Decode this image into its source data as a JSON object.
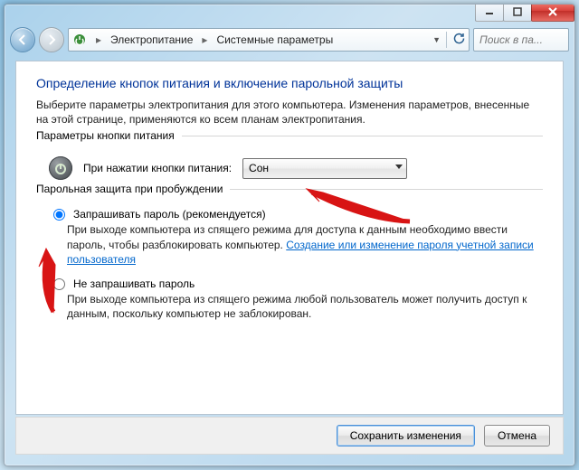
{
  "breadcrumb": {
    "item1": "Электропитание",
    "item2": "Системные параметры"
  },
  "search": {
    "placeholder": "Поиск в па..."
  },
  "page": {
    "heading": "Определение кнопок питания и включение парольной защиты",
    "description": "Выберите параметры электропитания для этого компьютера. Изменения параметров, внесенные на этой странице, применяются ко всем планам электропитания."
  },
  "powerButtons": {
    "legend": "Параметры кнопки питания",
    "label": "При нажатии кнопки питания:",
    "value": "Сон"
  },
  "passwordProtect": {
    "legend": "Парольная защита при пробуждении",
    "opt1": {
      "title": "Запрашивать пароль (рекомендуется)",
      "desc_a": "При выходе компьютера из спящего режима для доступа к данным необходимо ввести пароль, чтобы разблокировать компьютер. ",
      "link": "Создание или изменение пароля учетной записи пользователя"
    },
    "opt2": {
      "title": "Не запрашивать пароль",
      "desc": "При выходе компьютера из спящего режима любой пользователь может получить доступ к данным, поскольку компьютер не заблокирован."
    }
  },
  "buttons": {
    "save": "Сохранить изменения",
    "cancel": "Отмена"
  }
}
